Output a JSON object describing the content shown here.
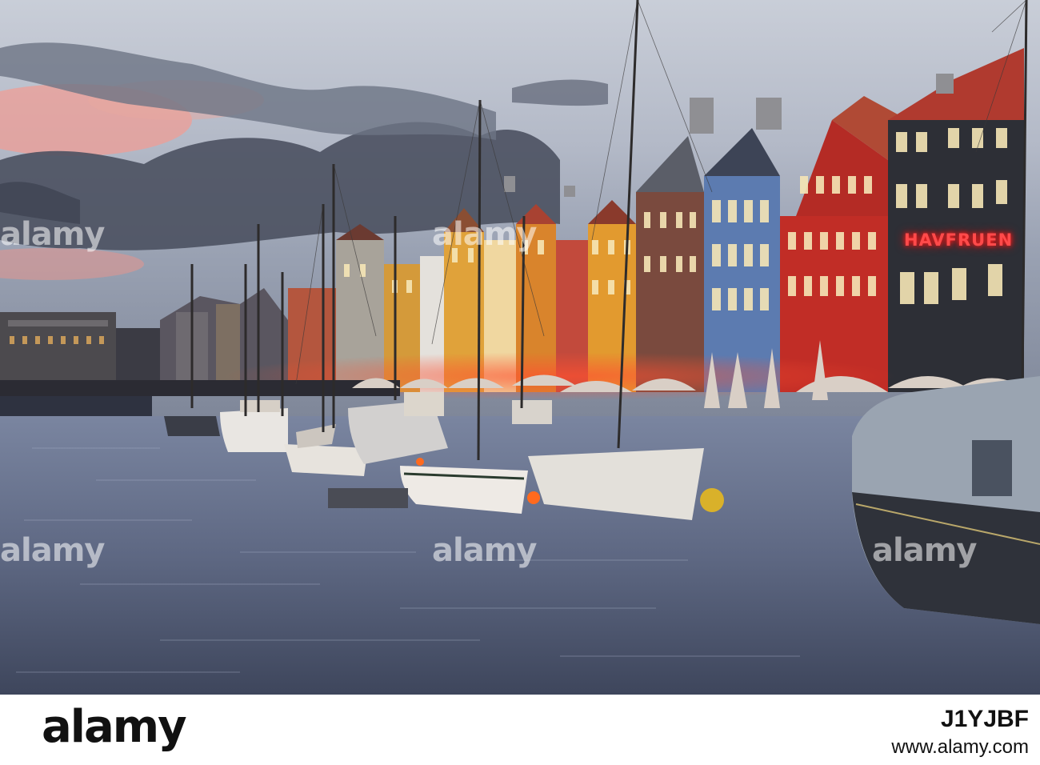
{
  "photo": {
    "sign_text": "HAVFRUEN",
    "watermark": "alamy",
    "colors": {
      "sky_top": "#a8b3c6",
      "sunset_pink": "#f09a93",
      "cloud_dark": "#4a505e",
      "water": "#65708a",
      "facade_red": "#c12d26",
      "facade_blue": "#5c7bb0",
      "facade_yellow": "#e0a23a",
      "facade_dark": "#2d2f36",
      "umbrella": "#d9cfc6"
    }
  },
  "footer": {
    "logo": "alamy",
    "image_id": "J1YJBF",
    "url": "www.alamy.com"
  }
}
